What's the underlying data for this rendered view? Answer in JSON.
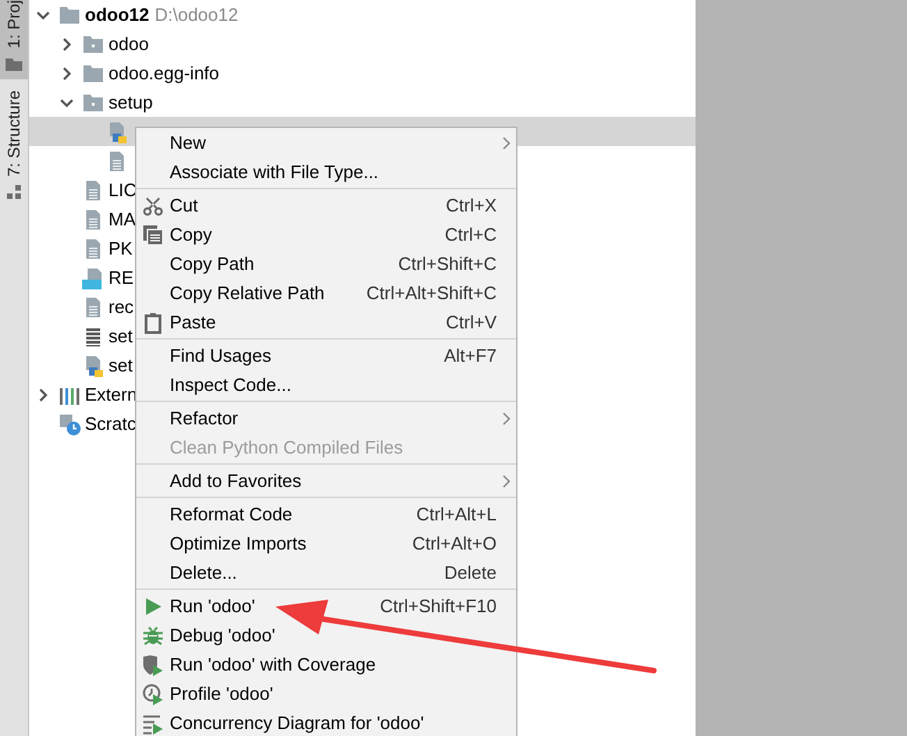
{
  "tool_tabs": [
    {
      "label": "1: Proj",
      "selected": true
    },
    {
      "label": "7: Structure",
      "selected": false
    }
  ],
  "tree": [
    {
      "label": "odoo12",
      "path": "D:\\odoo12",
      "kind": "folder",
      "expanded": true,
      "selected": false,
      "children": [
        {
          "label": "odoo",
          "kind": "package",
          "expanded": false,
          "selected": false
        },
        {
          "label": "odoo.egg-info",
          "kind": "folder",
          "expanded": false,
          "selected": false
        },
        {
          "label": "setup",
          "kind": "package",
          "expanded": true,
          "selected": false,
          "children": [
            {
              "kind": "python-file",
              "selected": true
            },
            {
              "kind": "text-file",
              "selected": false
            }
          ]
        },
        {
          "label": "LIC",
          "kind": "text-file",
          "selected": false
        },
        {
          "label": "MA",
          "kind": "text-file",
          "selected": false
        },
        {
          "label": "PK",
          "kind": "text-file",
          "selected": false
        },
        {
          "label": "RE",
          "kind": "markdown-file",
          "selected": false
        },
        {
          "label": "rec",
          "kind": "text-file",
          "selected": false
        },
        {
          "label": "set",
          "kind": "config-file",
          "selected": false
        },
        {
          "label": "set",
          "kind": "python-file",
          "selected": false
        }
      ]
    },
    {
      "label": "Extern",
      "kind": "libraries",
      "expanded": false,
      "selected": false
    },
    {
      "label": "Scratc",
      "kind": "scratches",
      "selected": false
    }
  ],
  "context_menu": [
    [
      {
        "label": "New",
        "submenu": true,
        "disabled": false
      },
      {
        "label": "Associate with File Type...",
        "submenu": false,
        "disabled": false
      }
    ],
    [
      {
        "label": "Cut",
        "shortcut": "Ctrl+X",
        "submenu": false,
        "disabled": false
      },
      {
        "label": "Copy",
        "shortcut": "Ctrl+C",
        "submenu": false,
        "disabled": false
      },
      {
        "label": "Copy Path",
        "shortcut": "Ctrl+Shift+C",
        "submenu": false,
        "disabled": false
      },
      {
        "label": "Copy Relative Path",
        "shortcut": "Ctrl+Alt+Shift+C",
        "submenu": false,
        "disabled": false
      },
      {
        "label": "Paste",
        "shortcut": "Ctrl+V",
        "submenu": false,
        "disabled": false
      }
    ],
    [
      {
        "label": "Find Usages",
        "shortcut": "Alt+F7",
        "submenu": false,
        "disabled": false
      },
      {
        "label": "Inspect Code...",
        "submenu": false,
        "disabled": false
      }
    ],
    [
      {
        "label": "Refactor",
        "submenu": true,
        "disabled": false
      },
      {
        "label": "Clean Python Compiled Files",
        "submenu": false,
        "disabled": true
      }
    ],
    [
      {
        "label": "Add to Favorites",
        "submenu": true,
        "disabled": false
      }
    ],
    [
      {
        "label": "Reformat Code",
        "shortcut": "Ctrl+Alt+L",
        "submenu": false,
        "disabled": false
      },
      {
        "label": "Optimize Imports",
        "shortcut": "Ctrl+Alt+O",
        "submenu": false,
        "disabled": false
      },
      {
        "label": "Delete...",
        "shortcut": "Delete",
        "submenu": false,
        "disabled": false
      }
    ],
    [
      {
        "label": "Run 'odoo'",
        "shortcut": "Ctrl+Shift+F10",
        "submenu": false,
        "disabled": false
      },
      {
        "label": "Debug 'odoo'",
        "submenu": false,
        "disabled": false
      },
      {
        "label": "Run 'odoo' with Coverage",
        "submenu": false,
        "disabled": false
      },
      {
        "label": "Profile 'odoo'",
        "submenu": false,
        "disabled": false
      },
      {
        "label": "Concurrency Diagram for 'odoo'",
        "submenu": false,
        "disabled": false
      }
    ]
  ],
  "annotation": {
    "kind": "arrow"
  }
}
